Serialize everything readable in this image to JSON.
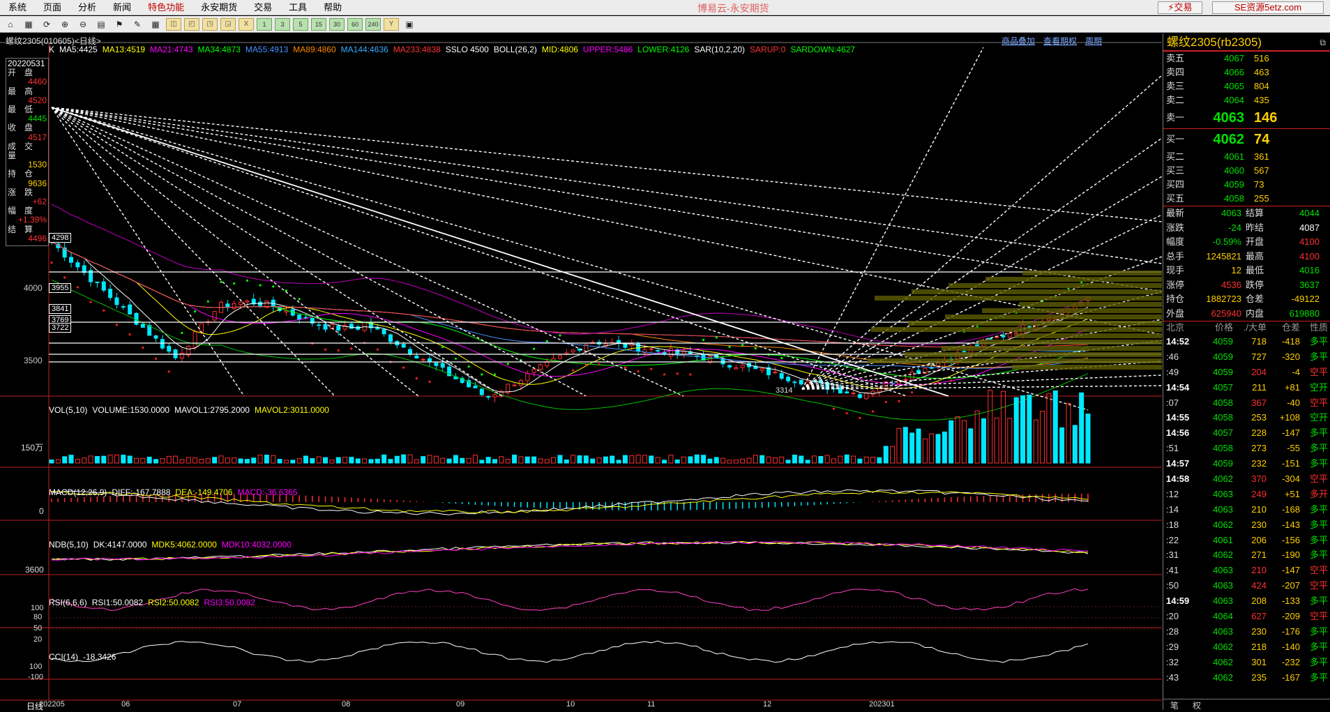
{
  "menu": [
    "系统",
    "页面",
    "分析",
    "新闻",
    "特色功能",
    "永安期货",
    "交易",
    "工具",
    "帮助"
  ],
  "app_title": "博易云-永安期货",
  "trade_button": "⚡交易",
  "site_button": "SE资源5etz.com",
  "toolbar_icons": [
    "home",
    "chart-f",
    "refresh",
    "zoom-in",
    "zoom-out",
    "layers",
    "tag",
    "pen",
    "table",
    "k-sel",
    "week",
    "month",
    "season",
    "x",
    "1",
    "3",
    "5",
    "15",
    "30",
    "60",
    "240",
    "year",
    "calc"
  ],
  "toolbar_labels": [
    "日",
    "周",
    "月",
    "季",
    "X",
    "1",
    "3",
    "5",
    "15",
    "30",
    "60",
    "240",
    "Y"
  ],
  "symbol_label": "螺纹2305(010605)<日线>",
  "top_links": [
    "商品叠加",
    "查看期权",
    "周期"
  ],
  "indicator_header": [
    {
      "t": "K",
      "c": "#ffffff"
    },
    {
      "t": "MA5:4425",
      "c": "#ffffff"
    },
    {
      "t": "MA13:4519",
      "c": "#ffff00"
    },
    {
      "t": "MA21:4743",
      "c": "#ff00ff"
    },
    {
      "t": "MA34:4873",
      "c": "#00ff00"
    },
    {
      "t": "MA55:4913",
      "c": "#4a90ff"
    },
    {
      "t": "MA89:4860",
      "c": "#ff8800"
    },
    {
      "t": "MA144:4636",
      "c": "#3aaaff"
    },
    {
      "t": "MA233:4838",
      "c": "#ff3333"
    },
    {
      "t": "SSLO 4500",
      "c": "#ffffff"
    },
    {
      "t": "BOLL(26,2)",
      "c": "#ffffff"
    },
    {
      "t": "MID:4806",
      "c": "#ffff00"
    },
    {
      "t": "UPPER:5486",
      "c": "#ff00ff"
    },
    {
      "t": "LOWER:4126",
      "c": "#00ff00"
    },
    {
      "t": "SAR(10,2,20)",
      "c": "#ffffff"
    },
    {
      "t": "SARUP:0",
      "c": "#ff3333"
    },
    {
      "t": "SARDOWN:4627",
      "c": "#00ff00"
    }
  ],
  "info_box": {
    "date": "20220531",
    "items": [
      {
        "k": "开盘",
        "v": "4460",
        "c": "#ff3030"
      },
      {
        "k": "最高",
        "v": "4520",
        "c": "#ff3030"
      },
      {
        "k": "最低",
        "v": "4445",
        "c": "#00e000"
      },
      {
        "k": "收盘",
        "v": "4517",
        "c": "#ff3030"
      },
      {
        "k": "成交量",
        "v": "1530",
        "c": "#ffd000"
      },
      {
        "k": "持仓",
        "v": "9636",
        "c": "#ffd000"
      },
      {
        "k": "涨跌",
        "v": "+62",
        "c": "#ff3030"
      },
      {
        "k": "幅度",
        "v": "+1.39%",
        "c": "#ff3030"
      },
      {
        "k": "结算",
        "v": "4496",
        "c": "#ff3030"
      }
    ]
  },
  "y_labels": [
    "4000",
    "3500"
  ],
  "price_boxes": [
    "4298",
    "3955",
    "3841",
    "3769",
    "3722"
  ],
  "low_label": "3314",
  "vol_header": [
    {
      "t": "VOL(5,10)",
      "c": "#ffffff"
    },
    {
      "t": "VOLUME:1530.0000",
      "c": "#ffffff"
    },
    {
      "t": "MAVOL1:2795.2000",
      "c": "#ffffff"
    },
    {
      "t": "MAVOL2:3011.0000",
      "c": "#ffff00"
    }
  ],
  "vol_ylabel": "150万",
  "macd_header": [
    {
      "t": "MACD(12,26,9)",
      "c": "#ffffff"
    },
    {
      "t": "DIFF:-167.7888",
      "c": "#ffffff"
    },
    {
      "t": "DEA:-149.4706",
      "c": "#ffff00"
    },
    {
      "t": "MACD:-36.6365",
      "c": "#ff00ff"
    }
  ],
  "macd_ylabel": "0",
  "ndb_header": [
    {
      "t": "NDB(5,10)",
      "c": "#ffffff"
    },
    {
      "t": "DK:4147.0000",
      "c": "#ffffff"
    },
    {
      "t": "MDK5:4062.0000",
      "c": "#ffff00"
    },
    {
      "t": "MDK10:4032.0000",
      "c": "#ff00ff"
    }
  ],
  "ndb_ylabel": "3600",
  "rsi_header": [
    {
      "t": "RSI(6,6,6)",
      "c": "#ffffff"
    },
    {
      "t": "RSI1:50.0082",
      "c": "#ffffff"
    },
    {
      "t": "RSI2:50.0082",
      "c": "#ffff00"
    },
    {
      "t": "RSI3:50.0082",
      "c": "#ff00ff"
    }
  ],
  "rsi_ylabels": [
    "100",
    "80",
    "50",
    "20"
  ],
  "cci_header": [
    {
      "t": "CCI(14)",
      "c": "#ffffff"
    },
    {
      "t": "-18.3426",
      "c": "#ffffff"
    }
  ],
  "cci_ylabels": [
    "100",
    "-100"
  ],
  "x_axis_left": "日线",
  "x_axis": [
    "202205",
    "06",
    "07",
    "08",
    "09",
    "10",
    "11",
    "12",
    "202301"
  ],
  "quote": {
    "title": "螺纹2305(rb2305)",
    "asks": [
      {
        "k": "卖五",
        "p": "4067",
        "v": "516"
      },
      {
        "k": "卖四",
        "p": "4066",
        "v": "463"
      },
      {
        "k": "卖三",
        "p": "4065",
        "v": "804"
      },
      {
        "k": "卖二",
        "p": "4064",
        "v": "435"
      }
    ],
    "ask1": {
      "k": "卖一",
      "p": "4063",
      "v": "146"
    },
    "bid1": {
      "k": "买一",
      "p": "4062",
      "v": "74"
    },
    "bids": [
      {
        "k": "买二",
        "p": "4061",
        "v": "361"
      },
      {
        "k": "买三",
        "p": "4060",
        "v": "567"
      },
      {
        "k": "买四",
        "p": "4059",
        "v": "73"
      },
      {
        "k": "买五",
        "p": "4058",
        "v": "255"
      }
    ],
    "stats": [
      {
        "a": "最新",
        "b": "4063",
        "bc": "#00e000",
        "c": "结算",
        "d": "4044",
        "dc": "#00e000"
      },
      {
        "a": "涨跌",
        "b": "-24",
        "bc": "#00e000",
        "c": "昨结",
        "d": "4087",
        "dc": "#ffffff"
      },
      {
        "a": "幅度",
        "b": "-0.59%",
        "bc": "#00e000",
        "c": "开盘",
        "d": "4100",
        "dc": "#ff3030"
      },
      {
        "a": "总手",
        "b": "1245821",
        "bc": "#ffd000",
        "c": "最高",
        "d": "4100",
        "dc": "#ff3030"
      },
      {
        "a": "现手",
        "b": "12",
        "bc": "#ffd000",
        "c": "最低",
        "d": "4016",
        "dc": "#00e000"
      },
      {
        "a": "涨停",
        "b": "4536",
        "bc": "#ff3030",
        "c": "跌停",
        "d": "3637",
        "dc": "#00e000"
      },
      {
        "a": "持仓",
        "b": "1882723",
        "bc": "#ffd000",
        "c": "仓差",
        "d": "-49122",
        "dc": "#ffd000"
      },
      {
        "a": "外盘",
        "b": "625940",
        "bc": "#ff3030",
        "c": "内盘",
        "d": "619880",
        "dc": "#00e000"
      }
    ],
    "tick_header": [
      "北京",
      "价格",
      "./大单",
      "仓差",
      "性质"
    ],
    "ticks": [
      {
        "t": "14:52",
        "p": "4059",
        "v": "718",
        "o": "-418",
        "oc": "#ffd000",
        "n": "多平",
        "nc": "#00e000",
        "bold": true
      },
      {
        "t": ":46",
        "p": "4059",
        "v": "727",
        "o": "-320",
        "oc": "#ffd000",
        "n": "多平",
        "nc": "#00e000"
      },
      {
        "t": ":49",
        "p": "4059",
        "v": "204",
        "vc": "#ff3030",
        "o": "-4",
        "oc": "#ffd000",
        "n": "空平",
        "nc": "#ff3030"
      },
      {
        "t": "14:54",
        "p": "4057",
        "v": "211",
        "o": "+81",
        "oc": "#ffd000",
        "n": "空开",
        "nc": "#00e000",
        "bold": true
      },
      {
        "t": ":07",
        "p": "4058",
        "v": "367",
        "vc": "#ff3030",
        "o": "-40",
        "oc": "#ffd000",
        "n": "空平",
        "nc": "#ff3030"
      },
      {
        "t": "14:55",
        "p": "4058",
        "v": "253",
        "o": "+108",
        "oc": "#ffd000",
        "n": "空开",
        "nc": "#00e000",
        "bold": true
      },
      {
        "t": "14:56",
        "p": "4057",
        "v": "228",
        "o": "-147",
        "oc": "#ffd000",
        "n": "多平",
        "nc": "#00e000",
        "bold": true
      },
      {
        "t": ":51",
        "p": "4058",
        "v": "273",
        "o": "-55",
        "oc": "#ffd000",
        "n": "多平",
        "nc": "#00e000"
      },
      {
        "t": "14:57",
        "p": "4059",
        "v": "232",
        "o": "-151",
        "oc": "#ffd000",
        "n": "多平",
        "nc": "#00e000",
        "bold": true
      },
      {
        "t": "14:58",
        "p": "4062",
        "v": "370",
        "vc": "#ff3030",
        "o": "-304",
        "oc": "#ffd000",
        "n": "空平",
        "nc": "#ff3030",
        "bold": true
      },
      {
        "t": ":12",
        "p": "4063",
        "v": "249",
        "vc": "#ff3030",
        "o": "+51",
        "oc": "#ffd000",
        "n": "多开",
        "nc": "#ff3030"
      },
      {
        "t": ":14",
        "p": "4063",
        "v": "210",
        "o": "-168",
        "oc": "#ffd000",
        "n": "多平",
        "nc": "#00e000"
      },
      {
        "t": ":18",
        "p": "4062",
        "v": "230",
        "o": "-143",
        "oc": "#ffd000",
        "n": "多平",
        "nc": "#00e000"
      },
      {
        "t": ":22",
        "p": "4061",
        "v": "206",
        "o": "-156",
        "oc": "#ffd000",
        "n": "多平",
        "nc": "#00e000"
      },
      {
        "t": ":31",
        "p": "4062",
        "v": "271",
        "o": "-190",
        "oc": "#ffd000",
        "n": "多平",
        "nc": "#00e000"
      },
      {
        "t": ":41",
        "p": "4063",
        "v": "210",
        "vc": "#ff3030",
        "o": "-147",
        "oc": "#ffd000",
        "n": "空平",
        "nc": "#ff3030"
      },
      {
        "t": ":50",
        "p": "4063",
        "v": "424",
        "vc": "#ff3030",
        "o": "-207",
        "oc": "#ffd000",
        "n": "空平",
        "nc": "#ff3030"
      },
      {
        "t": "14:59",
        "p": "4063",
        "v": "208",
        "o": "-133",
        "oc": "#ffd000",
        "n": "多平",
        "nc": "#00e000",
        "bold": true
      },
      {
        "t": ":20",
        "p": "4064",
        "v": "627",
        "vc": "#ff3030",
        "o": "-209",
        "oc": "#ffd000",
        "n": "空平",
        "nc": "#ff3030"
      },
      {
        "t": ":28",
        "p": "4063",
        "v": "230",
        "o": "-176",
        "oc": "#ffd000",
        "n": "多平",
        "nc": "#00e000"
      },
      {
        "t": ":29",
        "p": "4062",
        "v": "218",
        "o": "-140",
        "oc": "#ffd000",
        "n": "多平",
        "nc": "#00e000"
      },
      {
        "t": ":32",
        "p": "4062",
        "v": "301",
        "o": "-232",
        "oc": "#ffd000",
        "n": "多平",
        "nc": "#00e000"
      },
      {
        "t": ":43",
        "p": "4062",
        "v": "235",
        "o": "-167",
        "oc": "#ffd000",
        "n": "多平",
        "nc": "#00e000"
      }
    ],
    "tabs": [
      "笔",
      "权"
    ]
  }
}
